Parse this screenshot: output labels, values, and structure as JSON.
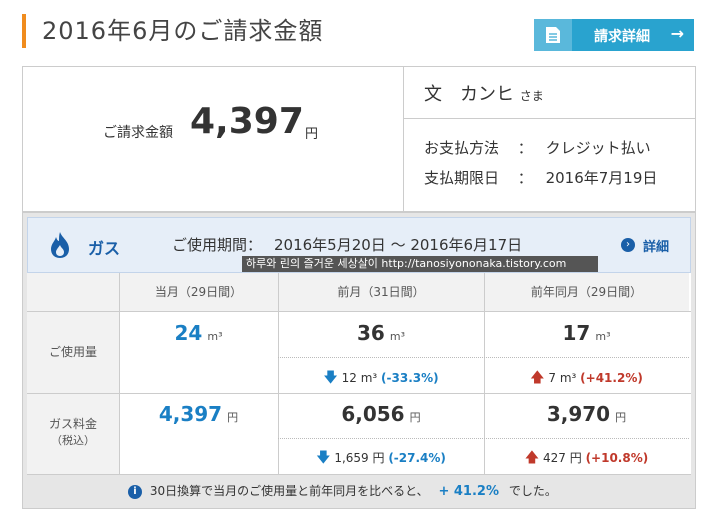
{
  "page_title": "2016年6月のご請求金額",
  "detail_button_label": "請求詳細",
  "detail_button_arrow": "→",
  "bill": {
    "amount_label": "ご請求金額",
    "amount_value": "4,397",
    "amount_unit": "円",
    "customer_name": "文　カンヒ",
    "customer_suffix": "さま",
    "payment_method_label": "お支払方法",
    "payment_method_value": "クレジット払い",
    "due_date_label": "支払期限日",
    "due_date_value": "2016年7月19日",
    "colon": "："
  },
  "gas": {
    "name": "ガス",
    "period_label": "ご使用期間：",
    "period_value": "2016年5月20日 〜 2016年6月17日",
    "more_label": "詳細",
    "watermark": "하루와 린의 즐거운 세상살이 http://tanosiyononaka.tistory.com",
    "columns": [
      "当月（29日間）",
      "前月（31日間）",
      "前年同月（29日間）"
    ],
    "usage": {
      "row_label": "ご使用量",
      "current": "24",
      "previous": "36",
      "previous_year": "17",
      "unit": "m³",
      "prev_diff": "12 m³",
      "prev_pct": "(-33.3%)",
      "year_diff": "7 m³",
      "year_pct": "(+41.2%)"
    },
    "charge": {
      "row_label": "ガス料金",
      "row_sublabel": "（税込）",
      "current": "4,397",
      "previous": "6,056",
      "previous_year": "3,970",
      "unit": "円",
      "prev_diff": "1,659 円",
      "prev_pct": "(-27.4%)",
      "year_diff": "427 円",
      "year_pct": "(+10.8%)"
    },
    "note_prefix": "30日換算で当月のご使用量と前年同月を比べると、",
    "note_pct": "+ 41.2%",
    "note_suffix": "でした。"
  },
  "colors": {
    "accent": "#f08c1e",
    "button": "#29a3cf",
    "blue": "#1a7fc4",
    "red": "#c0392b"
  },
  "icons": [
    "document-icon",
    "arrow-right-icon",
    "flame-icon",
    "chevron-right-icon",
    "down-arrow-icon",
    "up-arrow-icon",
    "info-icon"
  ]
}
